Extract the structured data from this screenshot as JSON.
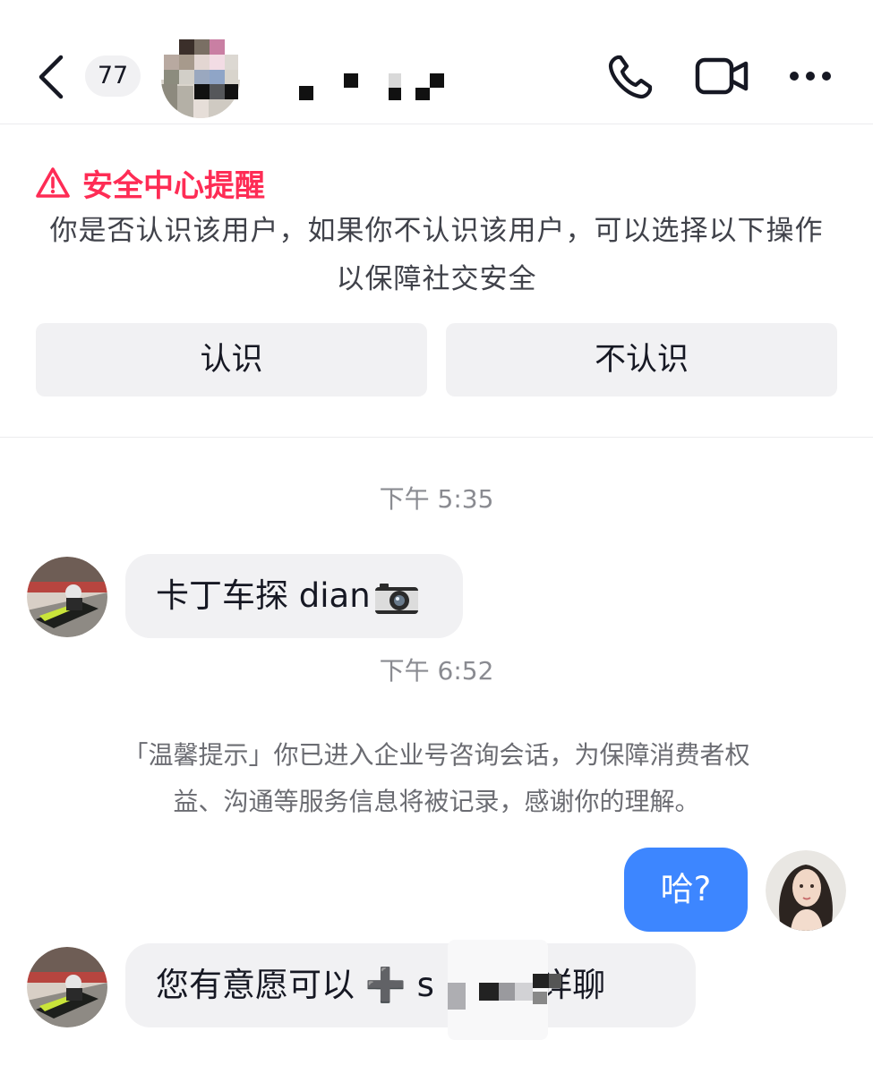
{
  "header": {
    "unread_count": "77"
  },
  "security_notice": {
    "title": "安全中心提醒",
    "body": "你是否认识该用户，如果你不认识该用户，可以选择以下操作以保障社交安全",
    "know_button": "认识",
    "dont_know_button": "不认识"
  },
  "chat": {
    "time_1": "下午 5:35",
    "message_1": "卡丁车探 dian",
    "time_2": "下午 6:52",
    "system_note": "「温馨提示」你已进入企业号咨询会话，为保障消费者权益、沟通等服务信息将被记录，感谢你的理解。",
    "my_message": "哈?",
    "message_2_prefix": "您有意愿可以 ➕ s",
    "message_2_suffix": "-详聊"
  },
  "colors": {
    "warning": "#fe2c55",
    "outgoing_bubble": "#3d86ff",
    "incoming_bubble": "#f1f1f3"
  },
  "icons": [
    "back-icon",
    "phone-icon",
    "video-icon",
    "more-icon",
    "warning-icon",
    "camera-emoji",
    "plus-emoji"
  ]
}
